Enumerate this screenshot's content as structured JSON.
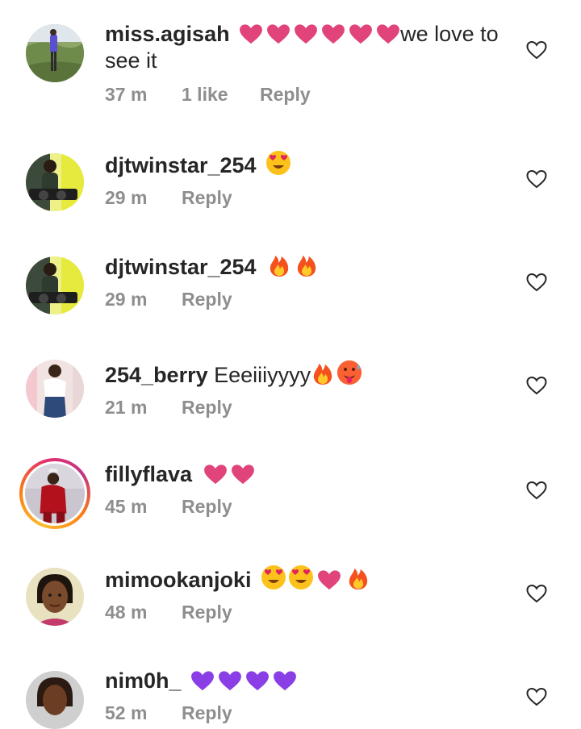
{
  "colors": {
    "text": "#262626",
    "meta": "#8e8e8e",
    "pink_heart": "#e1306c",
    "purple_heart": "#8a2be2"
  },
  "comments": [
    {
      "username": "miss.agisah",
      "emojis": [
        "pink-heart",
        "pink-heart",
        "pink-heart",
        "pink-heart",
        "pink-heart",
        "pink-heart"
      ],
      "text_line1": "we love to",
      "text_line2": "see it",
      "time": "37 m",
      "likes": "1 like",
      "reply": "Reply"
    },
    {
      "username": "djtwinstar_254",
      "emojis": [
        "heart-eyes"
      ],
      "time": "29 m",
      "reply": "Reply"
    },
    {
      "username": "djtwinstar_254",
      "emojis": [
        "fire",
        "fire"
      ],
      "time": "29 m",
      "reply": "Reply"
    },
    {
      "username": "254_berry",
      "text": "Eeeiiiyyyy",
      "emojis": [
        "fire",
        "hot-face"
      ],
      "time": "21 m",
      "reply": "Reply"
    },
    {
      "username": "fillyflava",
      "emojis": [
        "pink-heart",
        "pink-heart"
      ],
      "time": "45 m",
      "reply": "Reply"
    },
    {
      "username": "mimookanjoki",
      "emojis": [
        "heart-eyes",
        "heart-eyes",
        "pink-heart",
        "fire"
      ],
      "time": "48 m",
      "reply": "Reply"
    },
    {
      "username": "nim0h_",
      "emojis": [
        "purple-heart",
        "purple-heart",
        "purple-heart",
        "purple-heart"
      ],
      "time": "52 m",
      "reply": "Reply"
    }
  ]
}
